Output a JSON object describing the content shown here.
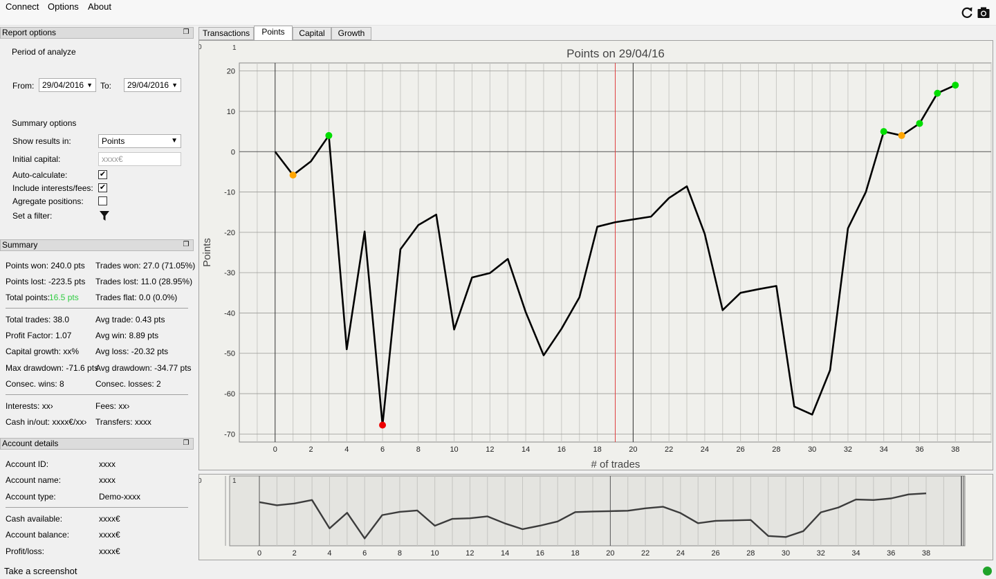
{
  "menu": {
    "items": [
      "Connect",
      "Options",
      "About"
    ]
  },
  "toolbar": {
    "icons": [
      "refresh-icon",
      "camera-icon"
    ]
  },
  "report_options": {
    "title": "Report options",
    "period_label": "Period of analyze",
    "from_label": "From:",
    "from_value": "29/04/2016",
    "to_label": "To:",
    "to_value": "29/04/2016",
    "summary_options_label": "Summary options",
    "show_results_label": "Show results in:",
    "show_results_value": "Points",
    "initial_capital_label": "Initial capital:",
    "initial_capital_placeholder": "xxxx€",
    "auto_calculate_label": "Auto-calculate:",
    "auto_calculate_checked": true,
    "include_interests_label": "Include interests/fees:",
    "include_interests_checked": true,
    "agregate_label": "Agregate positions:",
    "agregate_checked": false,
    "filter_label": "Set a filter:"
  },
  "summary": {
    "title": "Summary",
    "rows": [
      [
        "Points won: 240.0 pts",
        "Trades won: 27.0 (71.05%)"
      ],
      [
        "Points lost: -223.5 pts",
        "Trades lost: 11.0 (28.95%)"
      ],
      [
        "Total points: ",
        "Trades flat: 0.0 (0.0%)"
      ],
      [
        "Total trades: 38.0",
        "Avg trade: 0.43 pts"
      ],
      [
        "Profit Factor: 1.07",
        "Avg win: 8.89 pts"
      ],
      [
        "Capital growth: xx%",
        "Avg loss: -20.32 pts"
      ],
      [
        "Max drawdown: -71.6 pts",
        "Avg drawdown: -34.77 pts"
      ],
      [
        "Consec. wins: 8",
        "Consec. losses: 2"
      ],
      [
        "Interests: xx›",
        "Fees: xx›"
      ],
      [
        "Cash in/out: xxxx€/xx›",
        "Transfers: xxxx"
      ]
    ],
    "total_points_value": "16.5 pts",
    "total_points_color": "#2ecc40"
  },
  "account_details": {
    "title": "Account details",
    "rows": [
      [
        "Account ID:",
        "xxxx"
      ],
      [
        "Account name:",
        "xxxx"
      ],
      [
        "Account type:",
        "Demo-xxxx"
      ],
      [
        "Cash available:",
        "xxxx€"
      ],
      [
        "Account balance:",
        "xxxx€"
      ],
      [
        "Profit/loss:",
        "xxxx€"
      ]
    ]
  },
  "tabs": [
    "Transactions",
    "Points",
    "Capital",
    "Growth"
  ],
  "active_tab": "Points",
  "status": {
    "text": "Take a screenshot",
    "indicator_color": "#1fa32a"
  },
  "chart_data": {
    "type": "line",
    "title": "Points on 29/04/16",
    "xlabel": "# of trades",
    "ylabel": "Points",
    "xlim": [
      -2,
      40
    ],
    "ylim": [
      -72,
      22
    ],
    "xticks": [
      0,
      2,
      4,
      6,
      8,
      10,
      12,
      14,
      16,
      18,
      20,
      22,
      24,
      26,
      28,
      30,
      32,
      34,
      36,
      38
    ],
    "yticks": [
      20,
      10,
      0,
      -10,
      -20,
      -30,
      -40,
      -50,
      -60,
      -70
    ],
    "grid": true,
    "corner_labels": [
      "0",
      "1"
    ],
    "red_marker_x": 19,
    "series": [
      {
        "x": [
          0,
          1,
          2,
          3,
          4,
          5,
          6,
          7,
          8,
          9,
          10,
          11,
          12,
          13,
          14,
          15,
          16,
          17,
          18,
          19,
          20,
          21,
          22,
          23,
          24,
          25,
          26,
          27,
          28,
          29,
          30,
          31,
          32,
          33,
          34,
          35,
          36,
          37,
          38
        ],
        "values": [
          0,
          -5.8,
          -2.4,
          4,
          -49,
          -19.8,
          -67.8,
          -24.2,
          -18.2,
          -15.6,
          -44.1,
          -31.2,
          -30.1,
          -26.6,
          -39.8,
          -50.5,
          -43.9,
          -36.1,
          -18.6,
          -17.5,
          -16.8,
          -16.1,
          -11.5,
          -8.6,
          -20.4,
          -39.3,
          -35,
          -34.1,
          -33.3,
          -63.2,
          -65.2,
          -54.2,
          -19,
          -10,
          5,
          4,
          7,
          14.5,
          16.5
        ],
        "color": "#000000"
      }
    ],
    "markers": [
      {
        "x": 1,
        "y": -5.8,
        "color": "#ffa500"
      },
      {
        "x": 3,
        "y": 4,
        "color": "#00dd00"
      },
      {
        "x": 6,
        "y": -67.8,
        "color": "#ee0000"
      },
      {
        "x": 34,
        "y": 5,
        "color": "#00dd00"
      },
      {
        "x": 35,
        "y": 4,
        "color": "#ffa500"
      },
      {
        "x": 36,
        "y": 7,
        "color": "#00dd00"
      },
      {
        "x": 37,
        "y": 14.5,
        "color": "#00dd00"
      },
      {
        "x": 38,
        "y": 16.5,
        "color": "#00dd00"
      }
    ],
    "navigator": {
      "xticks": [
        0,
        2,
        4,
        6,
        8,
        10,
        12,
        14,
        16,
        18,
        20,
        22,
        24,
        26,
        28,
        30,
        32,
        34,
        36,
        38
      ],
      "line_color": "#3c3c3c"
    }
  }
}
